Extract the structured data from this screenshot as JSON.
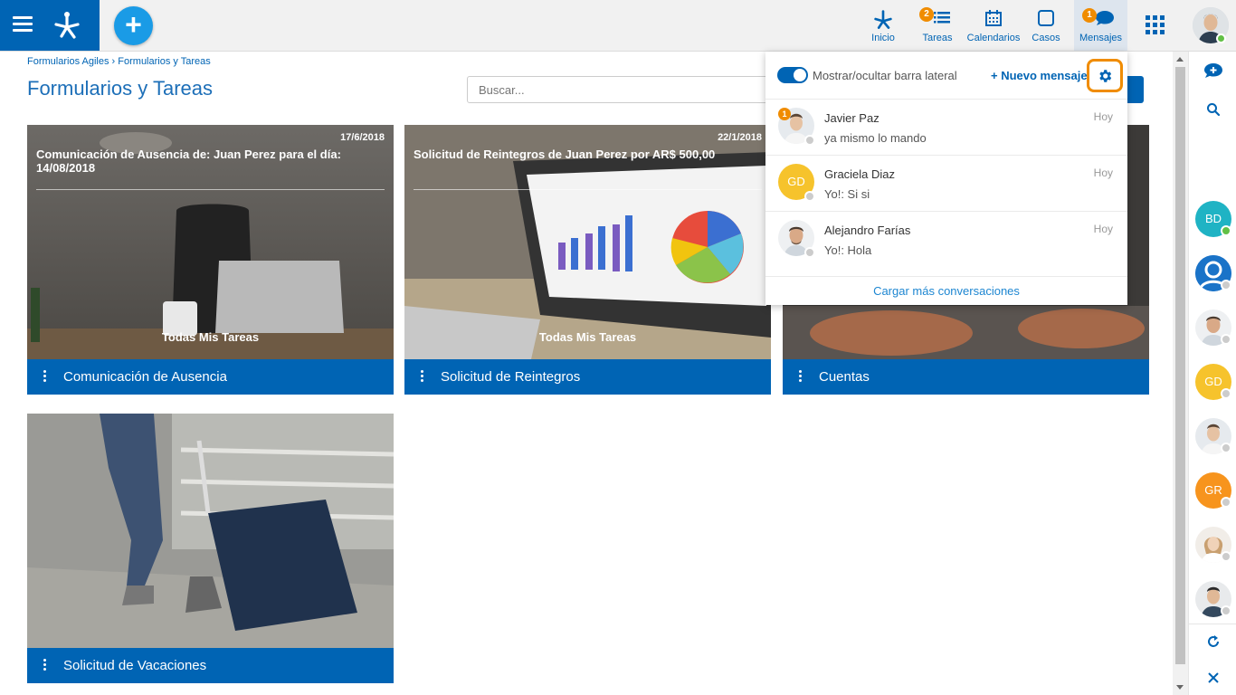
{
  "colors": {
    "primary": "#0064b4",
    "accent": "#1a9be6",
    "badge": "#f08c00",
    "online": "#62c046"
  },
  "header": {
    "nav": [
      {
        "label": "Inicio",
        "icon": "home-flow-icon"
      },
      {
        "label": "Tareas",
        "icon": "tasks-icon",
        "badge": "2"
      },
      {
        "label": "Calendarios",
        "icon": "calendar-icon"
      },
      {
        "label": "Casos",
        "icon": "cases-icon"
      },
      {
        "label": "Mensajes",
        "icon": "chat-icon",
        "badge": "1"
      }
    ]
  },
  "breadcrumb": {
    "root": "Formularios Agiles",
    "sep": "›",
    "current": "Formularios y Tareas"
  },
  "page": {
    "title": "Formularios y Tareas",
    "search_placeholder": "Buscar..."
  },
  "cards": [
    {
      "date": "17/6/2018",
      "desc": "Comunicación de Ausencia de: Juan Perez para el día: 14/08/2018",
      "link": "Todas Mis Tareas",
      "title": "Comunicación de Ausencia"
    },
    {
      "date": "22/1/2018",
      "desc": "Solicitud de Reintegros de Juan  Perez por  AR$  500,00",
      "link": "Todas Mis Tareas",
      "title": "Solicitud de Reintegros"
    },
    {
      "title": "Cuentas"
    },
    {
      "title": "Solicitud de Vacaciones"
    }
  ],
  "messages": {
    "toggle_label": "Mostrar/ocultar barra lateral",
    "new_message": "+ Nuevo mensaje",
    "conversations": [
      {
        "name": "Javier Paz",
        "text": "ya mismo lo mando",
        "time": "Hoy",
        "badge": "1"
      },
      {
        "name": "Graciela Diaz",
        "text": "Yo!: Si si",
        "time": "Hoy",
        "initials": "GD"
      },
      {
        "name": "Alejandro Farías",
        "text": "Yo!: Hola",
        "time": "Hoy"
      }
    ],
    "load_more": "Cargar más conversaciones"
  },
  "sidebar": {
    "contacts": [
      {
        "initials": "BD",
        "color": "#1fb3c4"
      },
      {
        "initials": "",
        "color": "#1a73c8"
      },
      {
        "initials": "",
        "color": "#c9a07a"
      },
      {
        "initials": "GD",
        "color": "#f6c32c"
      },
      {
        "initials": "",
        "color": "#b8c2cc"
      },
      {
        "initials": "GR",
        "color": "#f7941d"
      },
      {
        "initials": "",
        "color": "#e2c7a8"
      },
      {
        "initials": "",
        "color": "#8a99a8"
      }
    ]
  }
}
